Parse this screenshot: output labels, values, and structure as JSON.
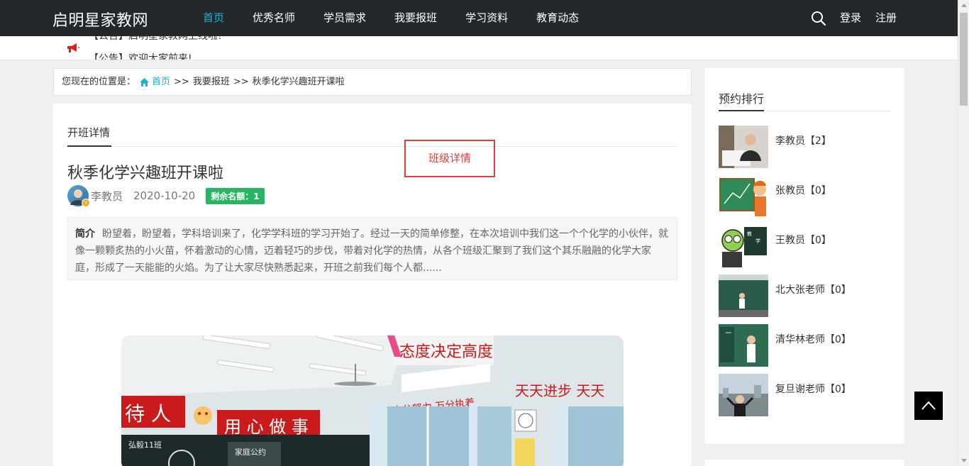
{
  "site": {
    "logo": "启明星家教网"
  },
  "nav": [
    {
      "label": "首页",
      "active": true
    },
    {
      "label": "优秀名师"
    },
    {
      "label": "学员需求"
    },
    {
      "label": "我要报班"
    },
    {
      "label": "学习资料"
    },
    {
      "label": "教育动态"
    }
  ],
  "auth": {
    "login": "登录",
    "register": "注册"
  },
  "notice": {
    "prev": "【公告】启明星家教网上线啦!",
    "current": "【公告】欢迎大家前来!"
  },
  "breadcrumb": {
    "prefix": "您现在的位置是：",
    "home": "首页",
    "sep": ">>",
    "level2": "我要报班",
    "current": "秋季化学兴趣班开课啦"
  },
  "article": {
    "tab": "开班详情",
    "annotation": "班级详情",
    "title": "秋季化学兴趣班开课啦",
    "author": "李教员",
    "date": "2020-10-20",
    "badge": "剩余名额：1",
    "summary_label": "简介",
    "summary": "盼望着，盼望着，学科培训来了，化学学科班的学习开始了。经过一天的简单修整，在本次培训中我们这一个个化学的小伙伴，就像一颗颗炙热的小火苗，怀着激动的心情，迈着轻巧的步伐，带着对化学的热情，从各个班级汇聚到了我们这个其乐融融的化学大家庭，形成了一天能能的火焰。为了让大家尽快熟悉起来，开班之前我们每个人都......",
    "photo_text": {
      "banner_top": "态度决定高度",
      "banner_left": "十分努力 万分执着",
      "banner_right": "天天进步 天天",
      "wall_left": "待 人",
      "wall_mid": "用 心 做 事",
      "board1": "家庭公约",
      "board2": "弘毅11班"
    }
  },
  "sidebar": {
    "title": "预约排行",
    "items": [
      {
        "name": "李教员【2】"
      },
      {
        "name": "张教员【0】"
      },
      {
        "name": "王教员【0】"
      },
      {
        "name": "北大张老师【0】"
      },
      {
        "name": "清华林老师【0】"
      },
      {
        "name": "复旦谢老师【0】"
      }
    ]
  },
  "colors": {
    "nav_bg": "#23282d",
    "accent": "#19b4d3",
    "badge": "#28b463",
    "annotation": "#e23d3d"
  },
  "icons": {
    "search": "search-icon",
    "notice": "megaphone-icon",
    "home": "home-icon",
    "totop": "chevron-up-icon"
  }
}
